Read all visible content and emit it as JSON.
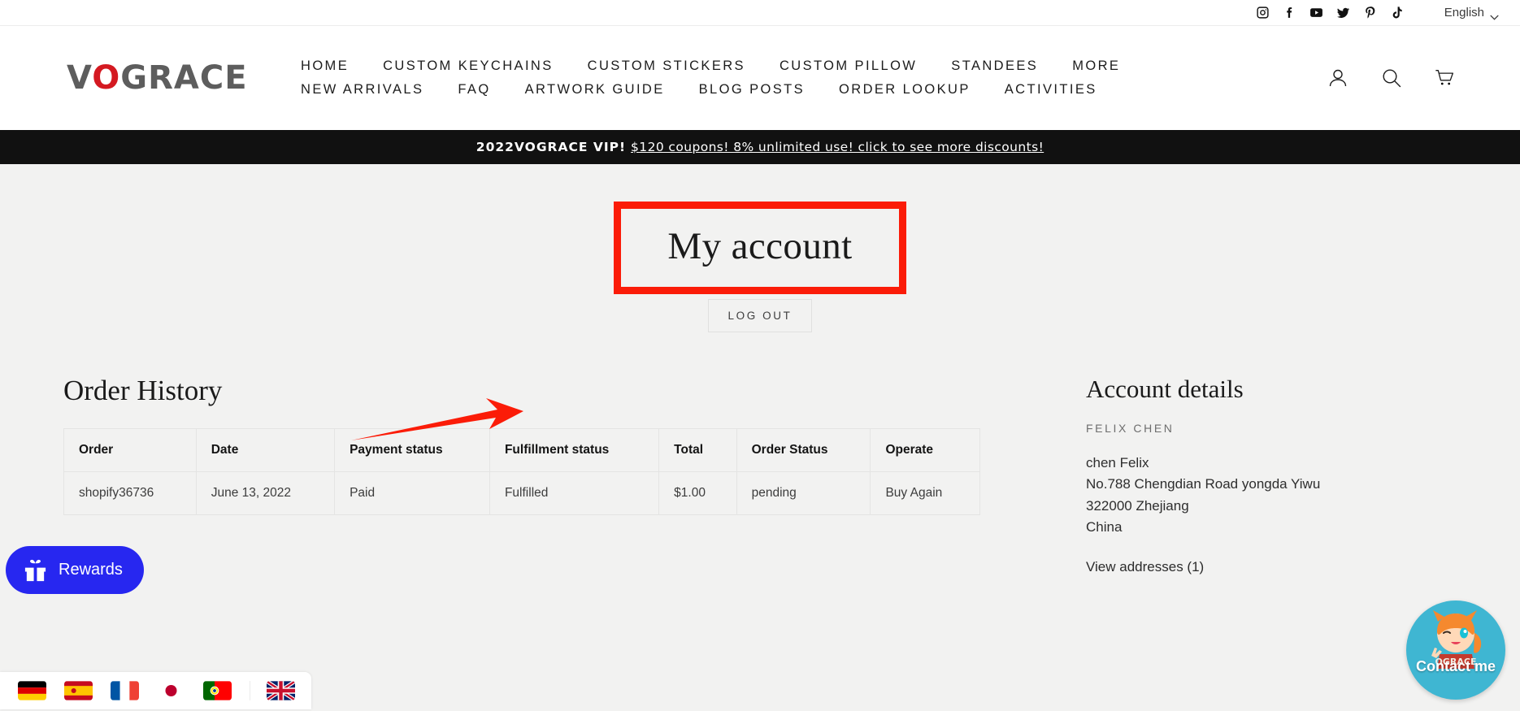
{
  "topbar": {
    "social": [
      {
        "name": "instagram-icon",
        "label": "Instagram"
      },
      {
        "name": "facebook-icon",
        "label": "Facebook"
      },
      {
        "name": "youtube-icon",
        "label": "YouTube"
      },
      {
        "name": "twitter-icon",
        "label": "Twitter"
      },
      {
        "name": "pinterest-icon",
        "label": "Pinterest"
      },
      {
        "name": "tiktok-icon",
        "label": "TikTok"
      }
    ],
    "language": "English"
  },
  "header": {
    "logo_prefix": "V",
    "logo_o": "O",
    "logo_suffix": "GRACE",
    "nav_row1": [
      "HOME",
      "CUSTOM KEYCHAINS",
      "CUSTOM STICKERS",
      "CUSTOM PILLOW",
      "STANDEES",
      "MORE"
    ],
    "nav_row2": [
      "NEW ARRIVALS",
      "FAQ",
      "ARTWORK GUIDE",
      "BLOG POSTS",
      "ORDER LOOKUP",
      "ACTIVITIES"
    ],
    "icons": [
      "account-icon",
      "search-icon",
      "cart-icon"
    ]
  },
  "announcement": {
    "strong": "2022VOGRACE VIP!",
    "link": "$120 coupons! 8% unlimited use! click to see more discounts!",
    "background": "#111111",
    "text_color": "#ffffff"
  },
  "account": {
    "title": "My account",
    "logout_label": "LOG OUT",
    "highlight_color": "#fb1c08"
  },
  "orders": {
    "section_title": "Order History",
    "columns": [
      "Order",
      "Date",
      "Payment status",
      "Fulfillment status",
      "Total",
      "Order Status",
      "Operate"
    ],
    "rows": [
      {
        "order": "shopify36736",
        "date": "June 13, 2022",
        "payment_status": "Paid",
        "fulfillment_status": "Fulfilled",
        "total": "$1.00",
        "order_status": "pending",
        "operate": "Buy Again"
      }
    ]
  },
  "account_details": {
    "section_title": "Account details",
    "customer_name": "FELIX CHEN",
    "address_lines": [
      "chen Felix",
      "No.788 Chengdian Road yongda Yiwu",
      "322000 Zhejiang",
      "China"
    ],
    "view_addresses": "View addresses (1)"
  },
  "rewards": {
    "label": "Rewards",
    "color": "#2727f0"
  },
  "flagbar": {
    "flags": [
      "flag-germany",
      "flag-spain",
      "flag-france",
      "flag-japan",
      "flag-portugal"
    ],
    "current_flag": "flag-united-kingdom"
  },
  "contact_widget": {
    "label": "Contact me",
    "color": "#3fb6d2"
  }
}
